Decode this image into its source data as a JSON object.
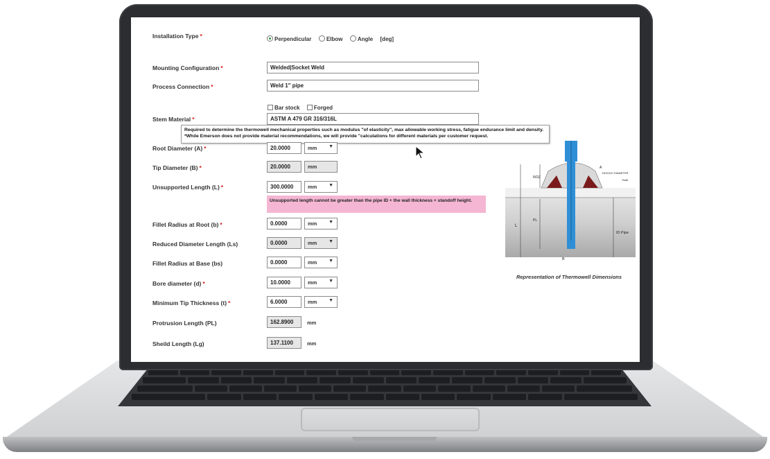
{
  "form": {
    "installation_type": {
      "label": "Installation Type",
      "options": [
        "Perpendicular",
        "Elbow",
        "Angle"
      ],
      "selected": "Perpendicular",
      "suffix": "[deg]"
    },
    "mounting_configuration": {
      "label": "Mounting Configuration",
      "value": "Welded|Socket Weld"
    },
    "process_connection": {
      "label": "Process Connection",
      "value": "Weld 1\" pipe"
    },
    "stock_options": [
      "Bar stock",
      "Forged"
    ],
    "stem_material": {
      "label": "Stem Material",
      "value": "ASTM A 479 GR 316/316L"
    },
    "root_diameter": {
      "label": "Root Diameter (A)",
      "value": "20.0000",
      "unit": "mm"
    },
    "tip_diameter": {
      "label": "Tip Diameter (B)",
      "value": "20.0000",
      "unit": "mm"
    },
    "unsupported_length": {
      "label": "Unsupported Length (L)",
      "value": "300.0000",
      "unit": "mm"
    },
    "fillet_radius_root": {
      "label": "Fillet Radius at Root (b)",
      "value": "0.0000",
      "unit": "mm"
    },
    "reduced_diameter_length": {
      "label": "Reduced Diameter Length (Ls)",
      "value": "0.0000",
      "unit": "mm"
    },
    "fillet_radius_base": {
      "label": "Fillet Radius at Base (bs)",
      "value": "0.0000",
      "unit": "mm"
    },
    "bore_diameter": {
      "label": "Bore diameter (d)",
      "value": "10.0000",
      "unit": "mm"
    },
    "min_tip_thickness": {
      "label": "Minimum Tip Thickness (t)",
      "value": "6.0000",
      "unit": "mm"
    },
    "protrusion_length": {
      "label": "Protrusion Length (PL)",
      "value": "162.8900",
      "unit": "mm"
    },
    "shield_length": {
      "label": "Sheild Length (Lg)",
      "value": "137.1100",
      "unit": "mm"
    }
  },
  "tooltip": "Required to determine the thermowell mechanical properties such as modulus \"of elasticity\", max allowable working stress, fatigue endurance limit and density. *While Emerson does not provide material recommendations, we will provide \"calculations for different materials per customer request.",
  "warning": "Unsupported length cannot be greater than the pipe ID + the wall thickness + standoff height.",
  "diagram": {
    "caption": "Representation of Thermowell Dimensions",
    "labels": {
      "a": "A",
      "nozzle": "NOZZLE DIAMETER",
      "twall": "Twall",
      "nozzle_height": "NOZ",
      "l": "L",
      "pl": "PL",
      "id_pipe": "ID Pipe",
      "b": "B"
    }
  },
  "colors": {
    "required": "#d81b1b",
    "thermowell": "#2f8fd6",
    "weld": "#7a1a1a",
    "warning_bg": "#f4b6d3"
  }
}
